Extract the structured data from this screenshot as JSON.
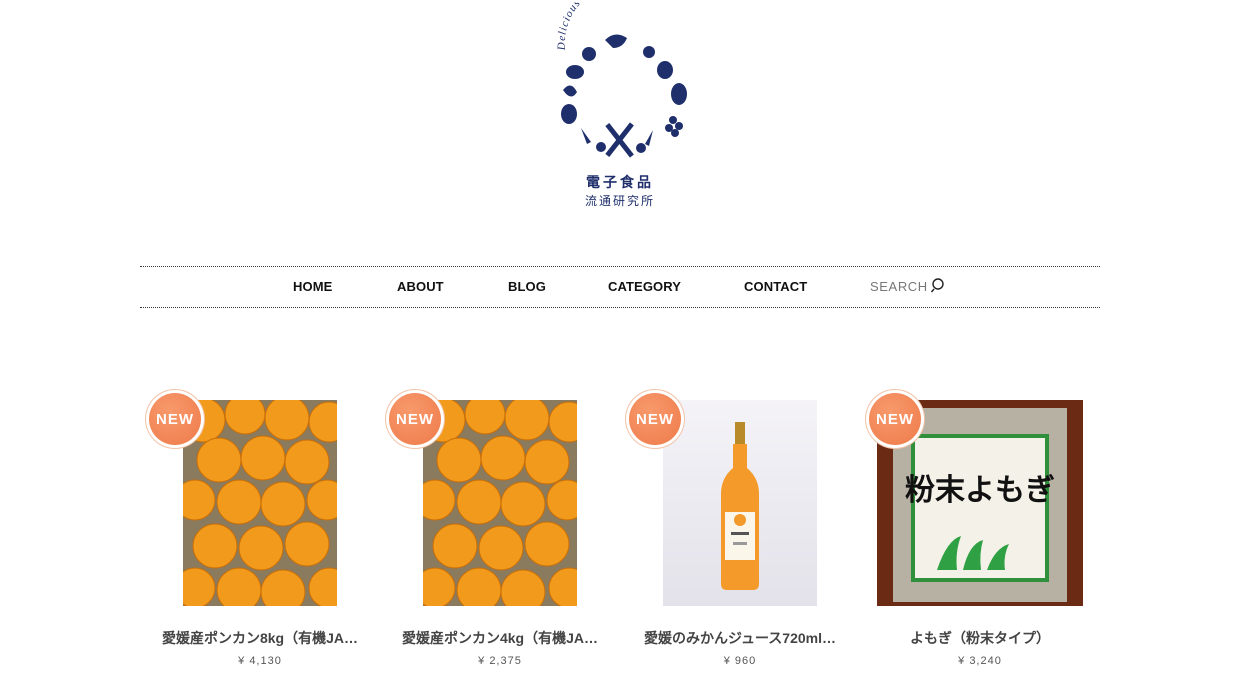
{
  "logo": {
    "tagline": "Delicious & Healthy",
    "name_line1": "電子食品",
    "name_line2": "流通研究所",
    "color": "#1f2f6b"
  },
  "nav": {
    "items": [
      {
        "label": "HOME"
      },
      {
        "label": "ABOUT"
      },
      {
        "label": "BLOG"
      },
      {
        "label": "CATEGORY"
      },
      {
        "label": "CONTACT"
      }
    ],
    "search_label": "SEARCH",
    "search_icon": "search-icon"
  },
  "badge_label": "NEW",
  "badge_color": "#ef7a4a",
  "products": [
    {
      "name": "愛媛産ポンカン8kg（有機JA…",
      "price": "¥ 4,130",
      "image": "oranges-box"
    },
    {
      "name": "愛媛産ポンカン4kg（有機JA…",
      "price": "¥ 2,375",
      "image": "oranges-box"
    },
    {
      "name": "愛媛のみかんジュース720ml…",
      "price": "¥ 960",
      "image": "juice-bottle"
    },
    {
      "name": "よもぎ（粉末タイプ）",
      "price": "¥ 3,240",
      "image": "yomogi-pack"
    }
  ],
  "yomogi_pack_text": "粉末よもぎ"
}
